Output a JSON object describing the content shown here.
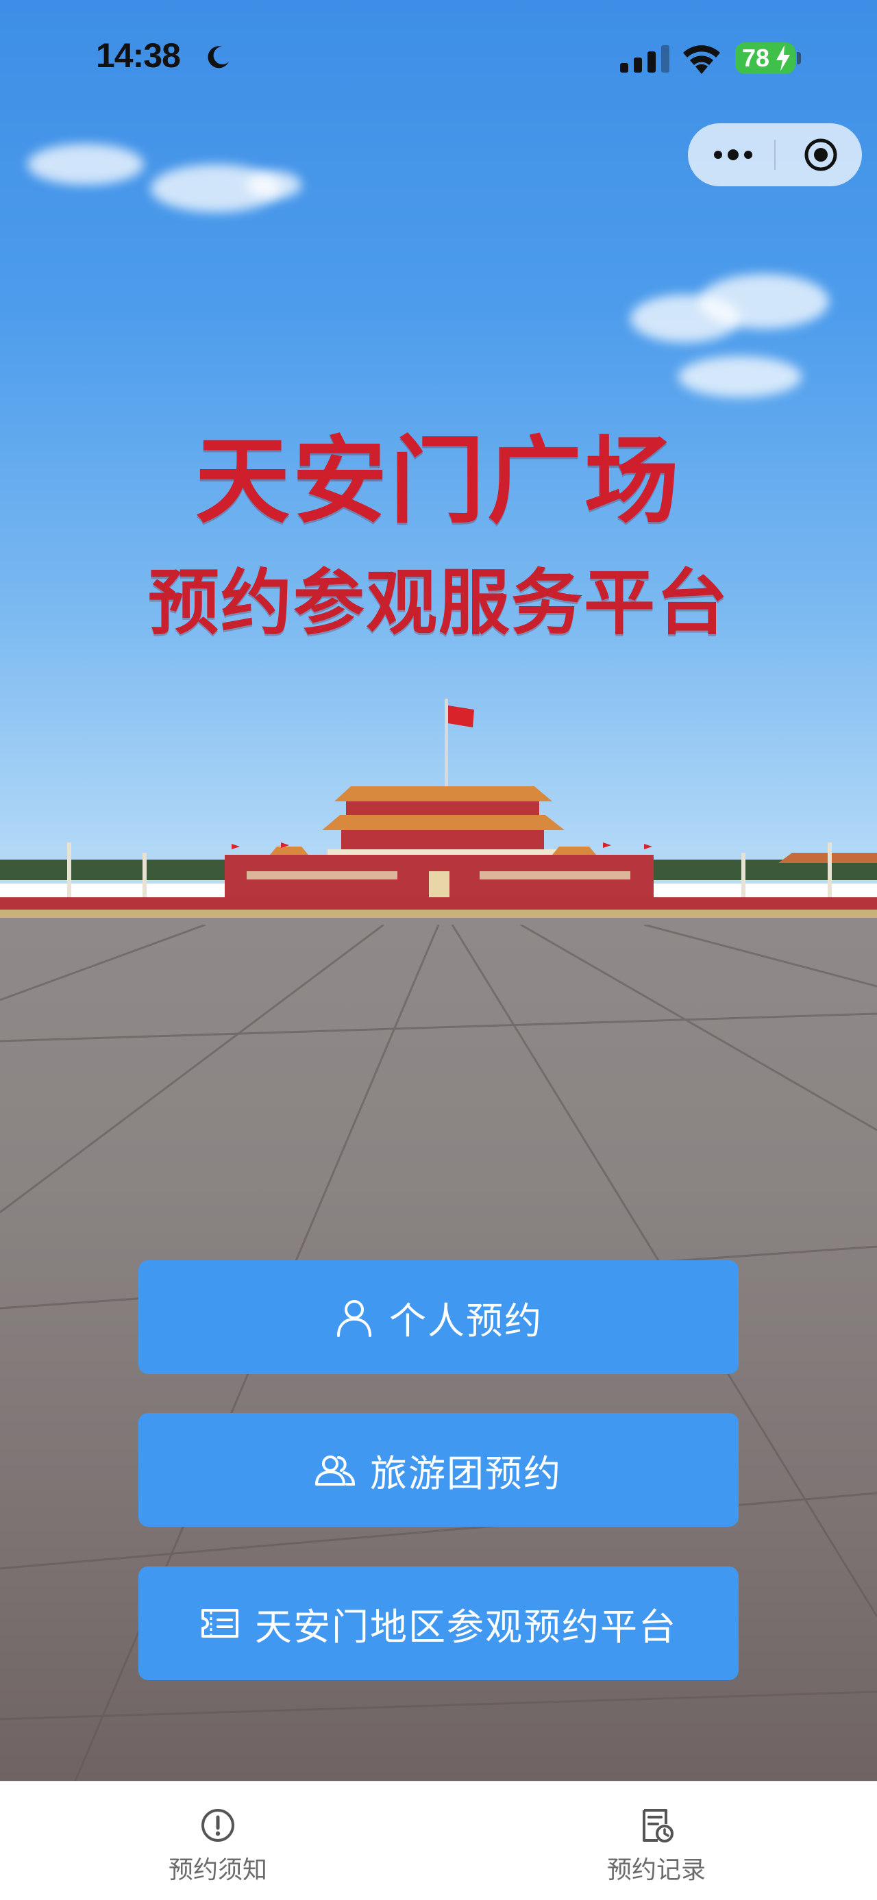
{
  "status_bar": {
    "time": "14:38",
    "battery": "78",
    "icons": [
      "moon-icon",
      "signal-icon",
      "wifi-icon",
      "battery-icon"
    ]
  },
  "capsule": {
    "icons": [
      "more-icon",
      "target-icon"
    ]
  },
  "hero": {
    "title_line_1": "天安门广场",
    "title_line_2": "预约参观服务平台"
  },
  "actions": {
    "personal": {
      "label": "个人预约",
      "icon": "person-icon"
    },
    "group": {
      "label": "旅游团预约",
      "icon": "group-icon"
    },
    "platform": {
      "label": "天安门地区参观预约平台",
      "icon": "ticket-icon"
    }
  },
  "tab_bar": {
    "notice": {
      "label": "预约须知",
      "icon": "exclamation-circle-icon"
    },
    "records": {
      "label": "预约记录",
      "icon": "document-clock-icon"
    }
  },
  "colors": {
    "title_red": "#d01f2c",
    "button_blue": "#4198f1",
    "tab_label": "#6b6b6b"
  }
}
